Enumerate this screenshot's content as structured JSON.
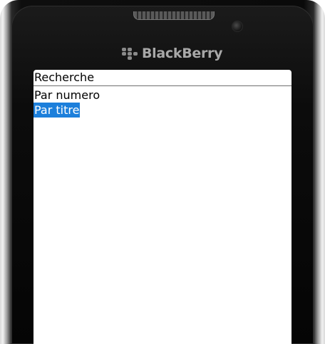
{
  "device": {
    "brand": "BlackBerry"
  },
  "screen": {
    "title": "Recherche",
    "menu": {
      "items": [
        {
          "label": "Par numero",
          "selected": false
        },
        {
          "label": "Par titre",
          "selected": true
        }
      ]
    }
  },
  "colors": {
    "selection": "#1c7fdb",
    "frame": "#0a0a0a"
  },
  "icons": [
    "blackberry-logo-icon",
    "camera-lens-icon",
    "speaker-grille-icon"
  ]
}
